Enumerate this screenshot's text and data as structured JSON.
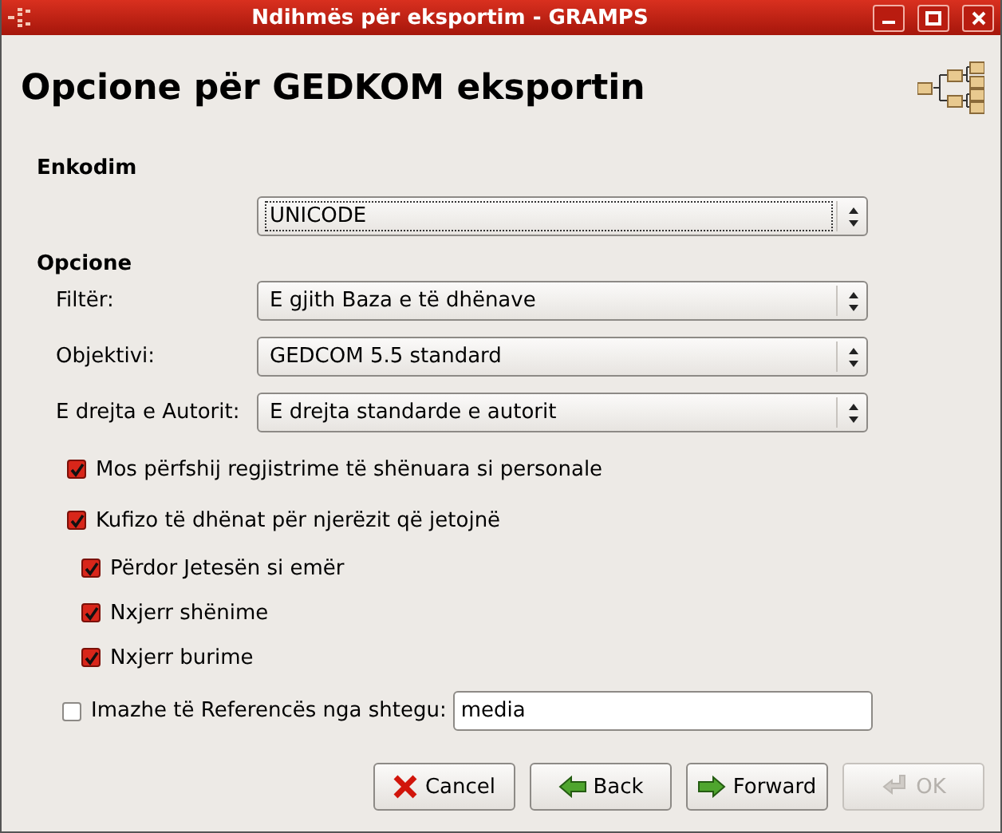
{
  "window": {
    "title": "Ndihmës për eksportim - GRAMPS"
  },
  "heading": "Opcione për GEDKOM eksportin",
  "encoding": {
    "label": "Enkodim",
    "value": "UNICODE",
    "focused": true
  },
  "options": {
    "label": "Opcione",
    "combos": [
      {
        "label": "Filtër:",
        "value": "E gjith Baza e të dhënave"
      },
      {
        "label": "Objektivi:",
        "value": "GEDCOM 5.5 standard"
      },
      {
        "label": "E drejta e Autorit:",
        "value": "E drejta standarde e autorit"
      }
    ],
    "checks": [
      {
        "label": "Mos përfshij regjistrime të shënuara si personale",
        "checked": true
      },
      {
        "label": "Kufizo të dhënat për njerëzit që jetojnë",
        "checked": true,
        "children": [
          {
            "label": "Përdor Jetesën si emër",
            "checked": true
          },
          {
            "label": "Nxjerr shënime",
            "checked": true
          },
          {
            "label": "Nxjerr burime",
            "checked": true
          }
        ]
      }
    ],
    "images": {
      "label": "Imazhe të Referencës nga shtegu:",
      "checked": false,
      "value": "media"
    }
  },
  "buttons": [
    {
      "kind": "cancel",
      "label": "Cancel",
      "disabled": false
    },
    {
      "kind": "back",
      "label": "Back",
      "disabled": false
    },
    {
      "kind": "forward",
      "label": "Forward",
      "disabled": false
    },
    {
      "kind": "ok",
      "label": "OK",
      "disabled": true
    }
  ]
}
